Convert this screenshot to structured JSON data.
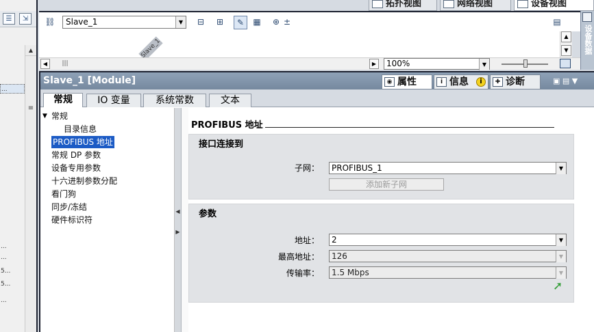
{
  "view_tabs": [
    {
      "label": "拓扑视图",
      "active": false
    },
    {
      "label": "网络视图",
      "active": false
    },
    {
      "label": "设备视图",
      "active": true
    }
  ],
  "toolbar": {
    "device_select": "Slave_1"
  },
  "canvas": {
    "device_label": "Slave_1"
  },
  "zoom": {
    "value": "100%"
  },
  "right_panel": {
    "label": "设备数据"
  },
  "left_strip": {
    "rows": [
      "...",
      "...",
      "...",
      "5...",
      "5...",
      "..."
    ]
  },
  "panel": {
    "title": "Slave_1 [Module]",
    "inspector_tabs": [
      {
        "label": "属性",
        "icon": "properties-icon",
        "active": true
      },
      {
        "label": "信息",
        "icon": "info-icon",
        "active": false
      },
      {
        "label": "诊断",
        "icon": "diagnostics-icon",
        "active": false
      }
    ],
    "info_badge": "i",
    "subtabs": [
      {
        "label": "常规",
        "active": true
      },
      {
        "label": "IO 变量",
        "active": false
      },
      {
        "label": "系统常数",
        "active": false
      },
      {
        "label": "文本",
        "active": false
      }
    ]
  },
  "nav_tree": {
    "root": "常规",
    "children": [
      "目录信息",
      "PROFIBUS 地址",
      "常规 DP 参数",
      "设备专用参数",
      "十六进制参数分配",
      "看门狗",
      "同步/冻结",
      "硬件标识符"
    ],
    "selected": "PROFIBUS 地址"
  },
  "content": {
    "section_title": "PROFIBUS 地址",
    "interface_group": {
      "title": "接口连接到",
      "subnet_label": "子网：",
      "subnet_value": "PROFIBUS_1",
      "add_subnet_button": "添加新子网"
    },
    "params_group": {
      "title": "参数",
      "address_label": "地址：",
      "address_value": "2",
      "highest_address_label": "最高地址：",
      "highest_address_value": "126",
      "baud_label": "传输率：",
      "baud_value": "1.5 Mbps"
    }
  },
  "colors": {
    "panel_header": "#8fa2b7",
    "selection": "#1c5bc5",
    "group_bg": "#e1e3e6",
    "go_arrow": "#2f9c33"
  }
}
